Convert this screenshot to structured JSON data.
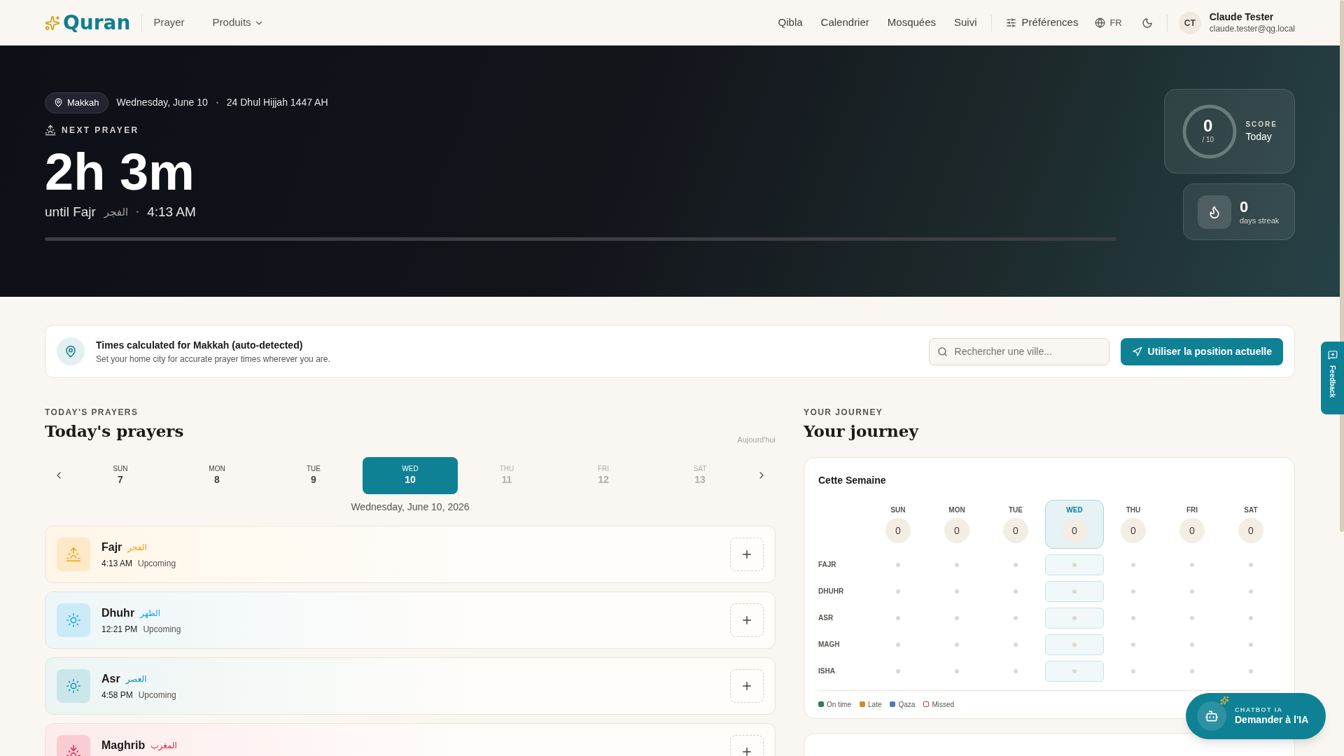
{
  "header": {
    "logo": "Quran",
    "nav_left": [
      {
        "label": "Prayer",
        "dropdown": false
      },
      {
        "label": "Produits",
        "dropdown": true
      }
    ],
    "nav_right": [
      "Qibla",
      "Calendrier",
      "Mosquées",
      "Suivi"
    ],
    "preferences": "Préférences",
    "language": "FR",
    "user": {
      "initials": "CT",
      "name": "Claude Tester",
      "email": "claude.tester@qg.local"
    }
  },
  "hero": {
    "location": "Makkah",
    "date": "Wednesday, June 10",
    "hijri_date": "24 Dhul Hijjah 1447 AH",
    "eyebrow": "NEXT PRAYER",
    "countdown": "2h 3m",
    "until": "until Fajr",
    "arabic": "الفجر",
    "time": "4:13 AM",
    "score": {
      "value": "0",
      "max": "/ 10",
      "label": "SCORE",
      "period": "Today"
    },
    "streak": {
      "value": "0",
      "label": "days streak"
    }
  },
  "banner": {
    "title": "Times calculated for Makkah (auto-detected)",
    "subtitle": "Set your home city for accurate prayer times wherever you are.",
    "search_placeholder": "Rechercher une ville...",
    "button": "Utiliser la position actuelle"
  },
  "prayers_section": {
    "eyebrow": "TODAY'S PRAYERS",
    "title": "Today's prayers",
    "today_link": "Aujourd'hui",
    "days": [
      {
        "weekday": "SUN",
        "day": "7",
        "selected": false,
        "future": false
      },
      {
        "weekday": "MON",
        "day": "8",
        "selected": false,
        "future": false
      },
      {
        "weekday": "TUE",
        "day": "9",
        "selected": false,
        "future": false
      },
      {
        "weekday": "WED",
        "day": "10",
        "selected": true,
        "future": false
      },
      {
        "weekday": "THU",
        "day": "11",
        "selected": false,
        "future": true
      },
      {
        "weekday": "FRI",
        "day": "12",
        "selected": false,
        "future": true
      },
      {
        "weekday": "SAT",
        "day": "13",
        "selected": false,
        "future": true
      }
    ],
    "full_date": "Wednesday, June 10, 2026",
    "prayers": [
      {
        "name": "Fajr",
        "arabic": "الفجر",
        "time": "4:13 AM",
        "status": "Upcoming",
        "kind": "sunrise",
        "color": "#f59e0b"
      },
      {
        "name": "Dhuhr",
        "arabic": "الظهر",
        "time": "12:21 PM",
        "status": "Upcoming",
        "kind": "sun",
        "color": "#0ea5e9"
      },
      {
        "name": "Asr",
        "arabic": "العصر",
        "time": "4:58 PM",
        "status": "Upcoming",
        "kind": "sun",
        "color": "#0891b2"
      },
      {
        "name": "Maghrib",
        "arabic": "المغرب",
        "kind": "sunset",
        "color": "#e11d48"
      }
    ]
  },
  "journey": {
    "eyebrow": "YOUR JOURNEY",
    "title": "Your journey",
    "card_title": "Cette Semaine",
    "days": [
      {
        "weekday": "SUN",
        "score": "0",
        "selected": false
      },
      {
        "weekday": "MON",
        "score": "0",
        "selected": false
      },
      {
        "weekday": "TUE",
        "score": "0",
        "selected": false
      },
      {
        "weekday": "WED",
        "score": "0",
        "selected": true
      },
      {
        "weekday": "THU",
        "score": "0",
        "selected": false
      },
      {
        "weekday": "FRI",
        "score": "0",
        "selected": false
      },
      {
        "weekday": "SAT",
        "score": "0",
        "selected": false
      }
    ],
    "rows": [
      "FAJR",
      "DHUHR",
      "ASR",
      "MAGH",
      "ISHA"
    ],
    "legend": [
      {
        "label": "On time",
        "color": "#2f7d5b",
        "kind": "filled"
      },
      {
        "label": "Late",
        "color": "#d08a2a",
        "kind": "filled"
      },
      {
        "label": "Qaza",
        "color": "#4a7cc4",
        "kind": "filled"
      },
      {
        "label": "Missed",
        "color": "#c0392b",
        "kind": "outline"
      }
    ]
  },
  "feedback": "Feedback",
  "chatbot": {
    "eyebrow": "CHATBOT IA",
    "label": "Demander à l'IA"
  }
}
